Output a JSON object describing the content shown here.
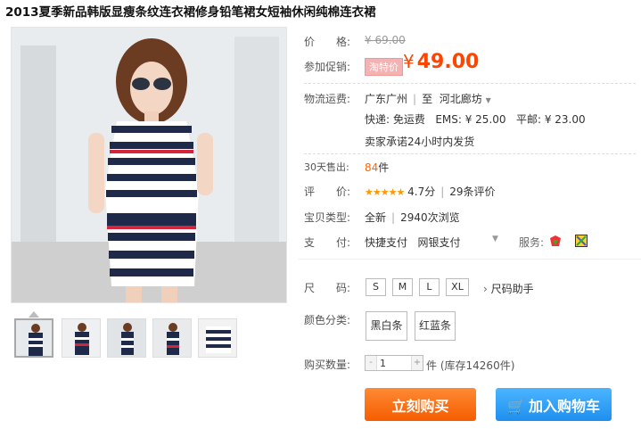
{
  "product": {
    "title": "2013夏季新品韩版显瘦条纹连衣裙修身铅笔裙女短袖休闲纯棉连衣裙"
  },
  "price": {
    "label": "价　　格:",
    "original": "¥ 69.00",
    "promo_label": "参加促销:",
    "promo_tag": "淘特价",
    "promo_currency": "¥",
    "promo_price": "49.00"
  },
  "shipping": {
    "label": "物流运费:",
    "from": "广东广州",
    "to_prefix": "至",
    "to": "河北廊坊",
    "express": "快递: 免运费",
    "ems": "EMS: ¥ 25.00",
    "mail": "平邮: ¥ 23.00",
    "promise": "卖家承诺24小时内发货"
  },
  "sales": {
    "label": "30天售出:",
    "count": "84",
    "unit": "件"
  },
  "rating": {
    "label": "评　　价:",
    "stars": "★★★★★",
    "score": "4.7分",
    "reviews": "29条评价"
  },
  "item_type": {
    "label": "宝贝类型:",
    "condition": "全新",
    "views": "2940次浏览"
  },
  "payment": {
    "label": "支　　付:",
    "method1": "快捷支付",
    "method2": "网银支付",
    "service_label": "服务:"
  },
  "sizes": {
    "label": "尺　　码:",
    "options": [
      "S",
      "M",
      "L",
      "XL"
    ],
    "helper": "尺码助手"
  },
  "colors": {
    "label": "颜色分类:",
    "options": [
      "黑白条",
      "红蓝条"
    ]
  },
  "quantity": {
    "label": "购买数量:",
    "value": "1",
    "minus": "-",
    "plus": "+",
    "unit": "件",
    "stock": "(库存14260件)"
  },
  "actions": {
    "buy_now": "立刻购买",
    "add_to_cart": "加入购物车"
  },
  "theme": {
    "accent": "#ff4400",
    "buy_color": "#f55d00",
    "cart_color": "#1e8fef"
  }
}
